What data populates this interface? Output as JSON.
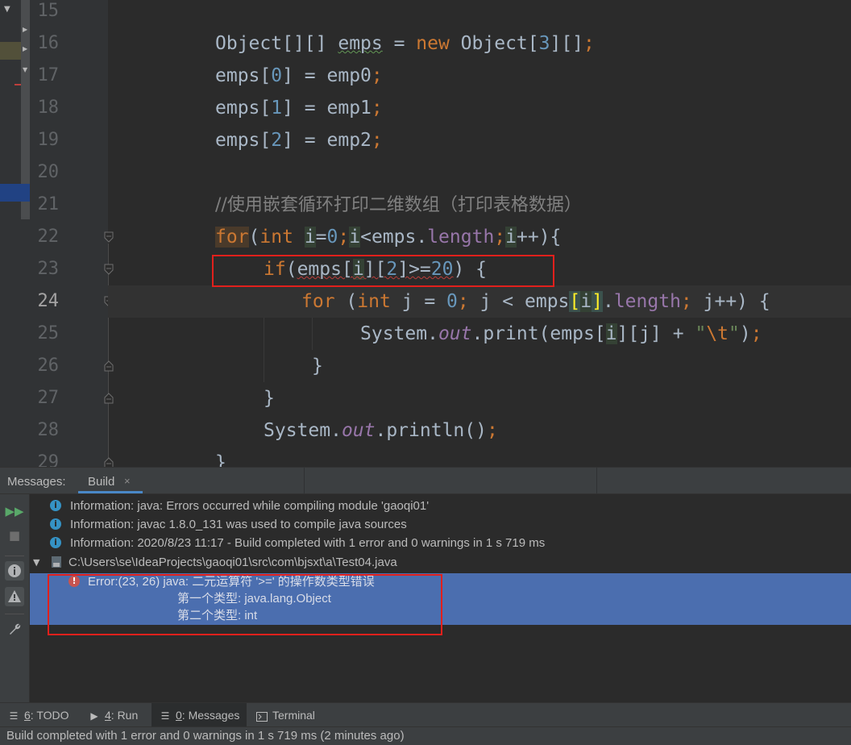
{
  "editor": {
    "line_numbers": [
      "15",
      "16",
      "17",
      "18",
      "19",
      "20",
      "21",
      "22",
      "23",
      "24",
      "25",
      "26",
      "27",
      "28",
      "29"
    ],
    "current_line": "24",
    "code": {
      "l16": {
        "type": "Object",
        "brackets1": "[][]",
        "var": "emps",
        "eq": " = ",
        "new": "new",
        "type2": " Object[",
        "n3": "3",
        "tail": "][]",
        "semi": ";"
      },
      "l17": {
        "a": "emps[",
        "n": "0",
        "b": "] = emp0",
        "semi": ";"
      },
      "l18": {
        "a": "emps[",
        "n": "1",
        "b": "] = emp1",
        "semi": ";"
      },
      "l19": {
        "a": "emps[",
        "n": "2",
        "b": "] = emp2",
        "semi": ";"
      },
      "l21": {
        "comment": "//使用嵌套循环打印二维数组（打印表格数据）"
      },
      "l22": {
        "for": "for",
        "p1": "(",
        "int": "int",
        "sp": " ",
        "i1": "i",
        "eq": "=",
        "zero": "0",
        "semi1": ";",
        "i2": "i",
        "lt": "<emps.",
        "length": "length",
        "semi2": ";",
        "i3": "i",
        "tail": "++){"
      },
      "l23": {
        "if": "if",
        "a": "(",
        "b": "emps[",
        "i": "i",
        "c": "][",
        "two": "2",
        "d": "]>=",
        "twenty": "20",
        "e": ") {"
      },
      "l24": {
        "for": "for",
        "a": " (",
        "int": "int",
        "b": " j = ",
        "zero": "0",
        "semi1": ";",
        "c": " j < emps",
        "lb": "[",
        "i": "i",
        "rb": "]",
        "dot": ".",
        "length": "length",
        "semi2": ";",
        "d": " j++) {"
      },
      "l25": {
        "sys": "System.",
        "out": "out",
        "a": ".print(emps[",
        "i": "i",
        "b": "][j] + ",
        "q1": "\"",
        "esc": "\\t",
        "q2": "\"",
        "c": ")",
        "semi": ";"
      },
      "l26": {
        "brace": "}"
      },
      "l27": {
        "brace": "}"
      },
      "l28": {
        "sys": "System.",
        "out": "out",
        "a": ".println()",
        "semi": ";"
      },
      "l29": {
        "brace": "}"
      }
    }
  },
  "messages": {
    "header_label": "Messages:",
    "tab_label": "Build",
    "tab_close": "×",
    "rows": [
      "Information: java: Errors occurred while compiling module 'gaoqi01'",
      "Information: javac 1.8.0_131 was used to compile java sources",
      "Information: 2020/8/23 11:17 - Build completed with 1 error and 0 warnings in 1 s 719 ms"
    ],
    "file_path": "C:\\Users\\se\\IdeaProjects\\gaoqi01\\src\\com\\bjsxt\\a\\Test04.java",
    "error": {
      "line1": "Error:(23, 26)  java: 二元运算符 '>=' 的操作数类型错误",
      "line2": "第一个类型:  java.lang.Object",
      "line3": "第二个类型: int"
    }
  },
  "tool_windows": [
    {
      "num": "6",
      "label": ": TODO"
    },
    {
      "num": "4",
      "label": ": Run"
    },
    {
      "num": "0",
      "label": ": Messages"
    },
    {
      "num": "",
      "label": "Terminal"
    }
  ],
  "status_text": "Build completed with 1 error and 0 warnings in 1 s 719 ms (2 minutes ago)",
  "colors": {
    "accent": "#4a88c7",
    "selection": "#4b6eaf",
    "error_box": "#e1201c",
    "keyword": "#cc7832",
    "number": "#6897bb"
  }
}
